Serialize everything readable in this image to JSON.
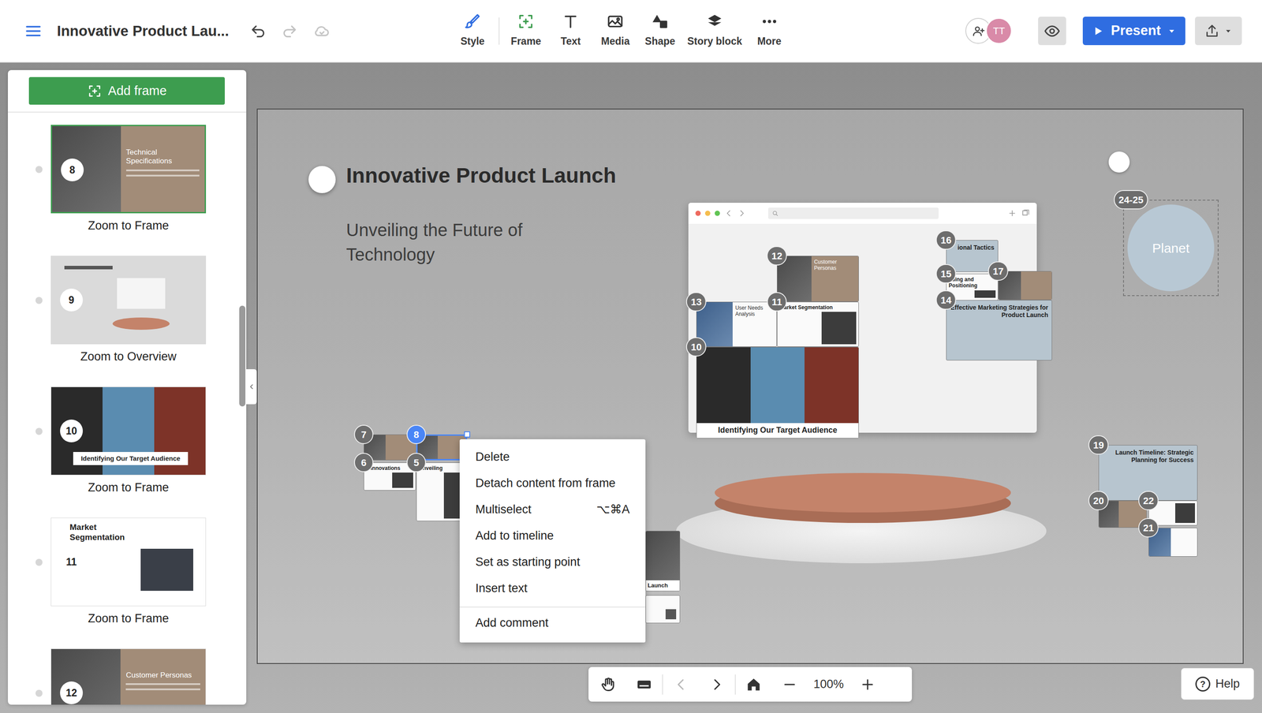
{
  "window": {
    "title": "Innovative Product Lau..."
  },
  "history": {
    "undo": {
      "disabled": false
    },
    "redo": {
      "disabled": true
    }
  },
  "toolbar": [
    {
      "label": "Style"
    },
    {
      "label": "Frame"
    },
    {
      "label": "Text"
    },
    {
      "label": "Media"
    },
    {
      "label": "Shape"
    },
    {
      "label": "Story block"
    },
    {
      "label": "More"
    }
  ],
  "header": {
    "avatar": "TT",
    "present": "Present"
  },
  "sidebar": {
    "add_frame": "Add frame",
    "frames": [
      {
        "number": "8",
        "title": "Technical Specifications",
        "caption": "Zoom to Frame",
        "selected": true,
        "kind": "split"
      },
      {
        "number": "9",
        "caption": "Zoom to Overview",
        "selected": false,
        "kind": "overview"
      },
      {
        "number": "10",
        "title": "Identifying Our Target Audience",
        "caption": "Zoom to Frame",
        "selected": false,
        "kind": "collage"
      },
      {
        "number": "11",
        "title": "Market Segmentation",
        "caption": "Zoom to Frame",
        "selected": false,
        "kind": "white"
      },
      {
        "number": "12",
        "title": "Customer Personas",
        "selected": false,
        "kind": "split"
      }
    ]
  },
  "canvas": {
    "title": "Innovative Product Launch",
    "subtitle": "Unveiling the Future of Technology",
    "planet": {
      "badge": "24-25",
      "label": "Planet"
    },
    "frames": [
      {
        "number": "7",
        "selected": false,
        "kind": "split"
      },
      {
        "number": "8",
        "selected": true,
        "kind": "split"
      },
      {
        "number": "6",
        "text": "y Innovations",
        "selected": false,
        "kind": "white"
      },
      {
        "number": "5",
        "text": "Unveiling",
        "selected": false,
        "kind": "white"
      },
      {
        "text": "Launch",
        "kind": "caption"
      },
      {
        "kind": "plain"
      },
      {
        "number": "12",
        "text": "Customer Personas",
        "selected": false,
        "kind": "split"
      },
      {
        "number": "13",
        "text": "User Needs Analysis",
        "selected": false,
        "kind": "photoleft"
      },
      {
        "number": "11",
        "text": "Market Segmentation",
        "selected": false,
        "kind": "white"
      },
      {
        "number": "10",
        "text": "Identifying Our Target Audience",
        "selected": false,
        "kind": "collage"
      },
      {
        "number": "16",
        "text": "ional Tactics",
        "selected": false,
        "kind": "blue"
      },
      {
        "number": "15",
        "text": "nding and Positioning",
        "selected": false,
        "kind": "white"
      },
      {
        "number": "17",
        "selected": false,
        "kind": "split"
      },
      {
        "number": "14",
        "text": "Effective Marketing Strategies for Product Launch",
        "selected": false,
        "kind": "blue"
      },
      {
        "number": "19",
        "text": "Launch Timeline: Strategic Planning for Success",
        "selected": false,
        "kind": "blue"
      },
      {
        "number": "20",
        "selected": false,
        "kind": "split"
      },
      {
        "number": "22",
        "selected": false,
        "kind": "white"
      },
      {
        "number": "21",
        "selected": false,
        "kind": "photoleft"
      }
    ]
  },
  "context_menu": {
    "items": [
      {
        "label": "Delete",
        "separated": false
      },
      {
        "label": "Detach content from frame",
        "separated": false
      },
      {
        "label": "Multiselect",
        "shortcut": "⌥⌘A",
        "separated": false
      },
      {
        "label": "Add to timeline",
        "separated": false
      },
      {
        "label": "Set as starting point",
        "separated": false
      },
      {
        "label": "Insert text",
        "separated": false
      },
      {
        "label": "Add comment",
        "separated": true
      }
    ]
  },
  "zoombar": {
    "zoom": "100%",
    "prev": {
      "disabled": true
    },
    "next": {
      "disabled": false
    }
  },
  "help": {
    "icon": "?",
    "label": "Help"
  }
}
